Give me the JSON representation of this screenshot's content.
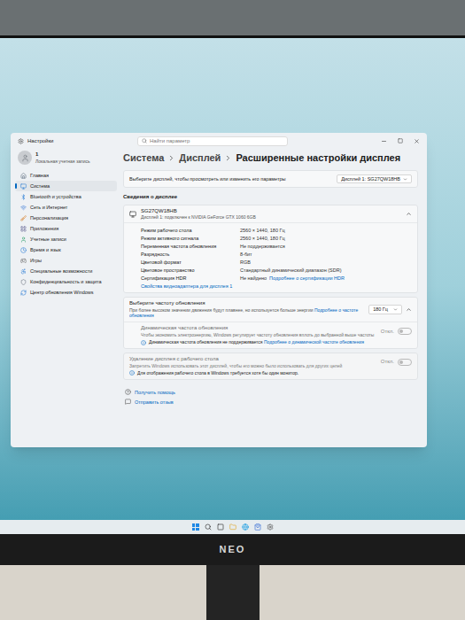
{
  "window": {
    "title": "Настройки",
    "search_placeholder": "Найти параметр"
  },
  "user": {
    "name": "1",
    "account": "Локальная учетная запись"
  },
  "sidebar": {
    "items": [
      {
        "label": "Главная",
        "selected": false
      },
      {
        "label": "Система",
        "selected": true
      },
      {
        "label": "Bluetooth и устройства",
        "selected": false
      },
      {
        "label": "Сеть и Интернет",
        "selected": false
      },
      {
        "label": "Персонализация",
        "selected": false
      },
      {
        "label": "Приложения",
        "selected": false
      },
      {
        "label": "Учетные записи",
        "selected": false
      },
      {
        "label": "Время и язык",
        "selected": false
      },
      {
        "label": "Игры",
        "selected": false
      },
      {
        "label": "Специальные возможности",
        "selected": false
      },
      {
        "label": "Конфиденциальность и защита",
        "selected": false
      },
      {
        "label": "Центр обновления Windows",
        "selected": false
      }
    ]
  },
  "breadcrumb": [
    "Система",
    "Дисплей",
    "Расширенные настройки дисплея"
  ],
  "display_select": {
    "label": "Выберите дисплей, чтобы просмотреть или изменить его параметры",
    "value": "Дисплей 1: SG27QW18HB"
  },
  "section_title": "Сведения о дисплее",
  "display_info": {
    "name": "SG27QW18HB",
    "subtitle": "Дисплей 1: подключен к NVIDIA GeForce GTX 1060 6GB",
    "expanded": true,
    "rows": [
      {
        "label": "Режим рабочего стола",
        "value": "2560 × 1440, 180 Гц"
      },
      {
        "label": "Режим активного сигнала",
        "value": "2560 × 1440, 180 Гц"
      },
      {
        "label": "Переменная частота обновления",
        "value": "Не поддерживается"
      },
      {
        "label": "Разрядность",
        "value": "8-бит"
      },
      {
        "label": "Цветовой формат",
        "value": "RGB"
      },
      {
        "label": "Цветовое пространство",
        "value": "Стандартный динамический диапазон (SDR)"
      },
      {
        "label": "Сертификация HDR",
        "value": "Не найдено",
        "link": "Подробнее о сертификации HDR"
      }
    ],
    "adapter_link": "Свойства видеоадаптера для дисплея 1"
  },
  "refresh_rate": {
    "title": "Выберите частоту обновления",
    "description": "При более высоком значении движения будут плавнее, но используется больше энергии",
    "link": "Подробнее о частоте обновления",
    "value": "180 Гц",
    "expanded": true,
    "dynamic": {
      "title": "Динамическая частота обновления",
      "description": "Чтобы экономить электроэнергию, Windows регулирует частоту обновления вплоть до выбранной выше частоты",
      "toggle_label": "Откл.",
      "on": false,
      "disabled": true,
      "note": "Динамическая частота обновления не поддерживается",
      "note_link": "Подробнее о динамической частоте обновления"
    }
  },
  "remove_display": {
    "title": "Удаление дисплея с рабочего стола",
    "description": "Запретить Windows использовать этот дисплей, чтобы его можно было использовать для других целей",
    "toggle_label": "Откл.",
    "on": false,
    "disabled": true,
    "note": "Для отображения рабочего стола в Windows требуется хотя бы один монитор."
  },
  "links": [
    "Получить помощь",
    "Отправить отзыв"
  ],
  "monitor": {
    "brand": "NEO"
  }
}
